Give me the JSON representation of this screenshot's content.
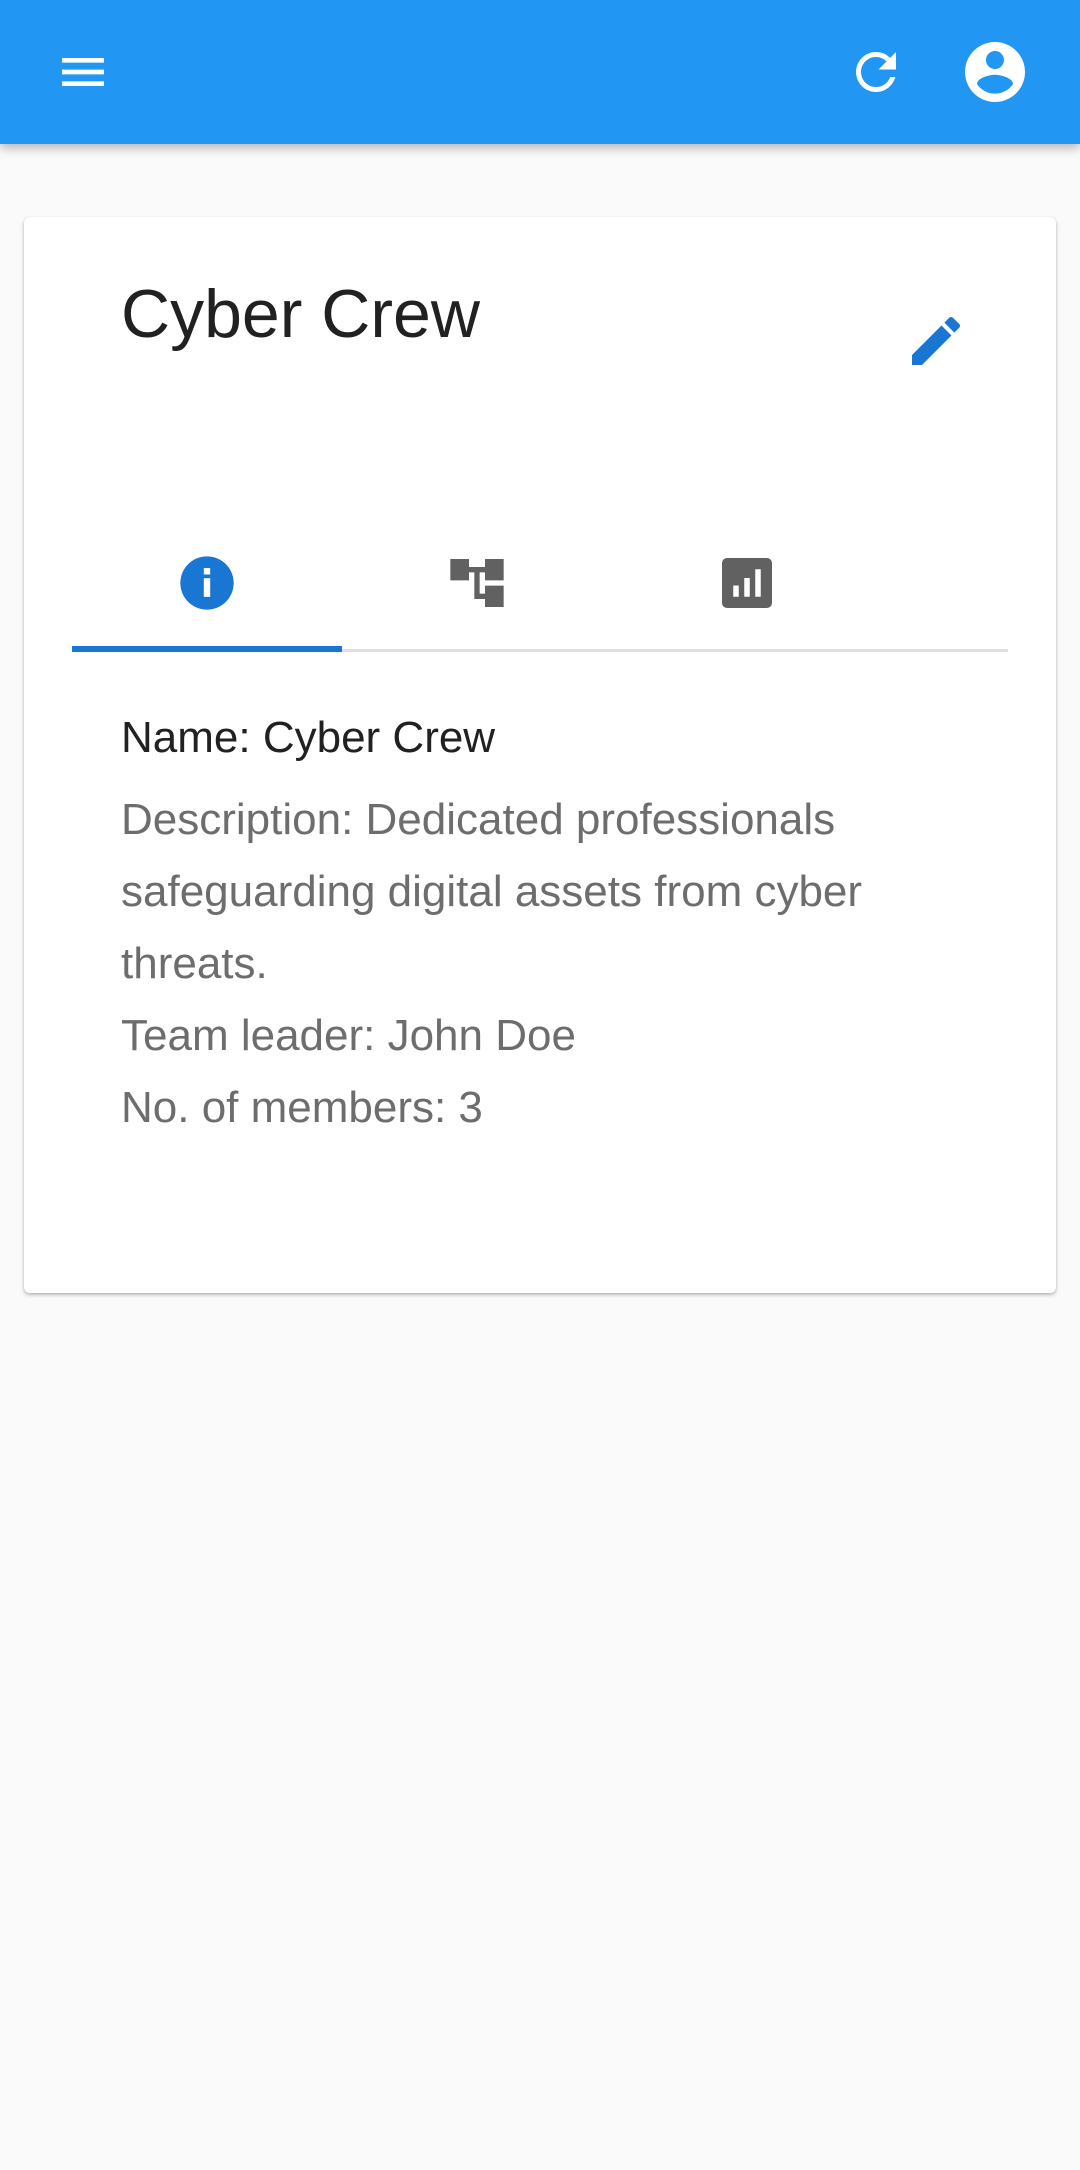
{
  "app_bar": {
    "menu_icon": "menu-icon",
    "refresh_icon": "refresh-icon",
    "account_icon": "account-circle-icon",
    "background_color": "#2196f3"
  },
  "team": {
    "title": "Cyber Crew",
    "edit_icon": "pencil-icon",
    "tabs": [
      {
        "icon": "info-icon",
        "selected": true
      },
      {
        "icon": "hierarchy-icon",
        "selected": false
      },
      {
        "icon": "bar-chart-icon",
        "selected": false
      }
    ],
    "details": {
      "name": "Name: Cyber Crew",
      "description": "Description: Dedicated professionals safeguarding digital assets from cyber threats.",
      "team_leader": "Team leader: John Doe",
      "members": "No. of members: 3"
    },
    "accent_color": "#1976d2"
  }
}
